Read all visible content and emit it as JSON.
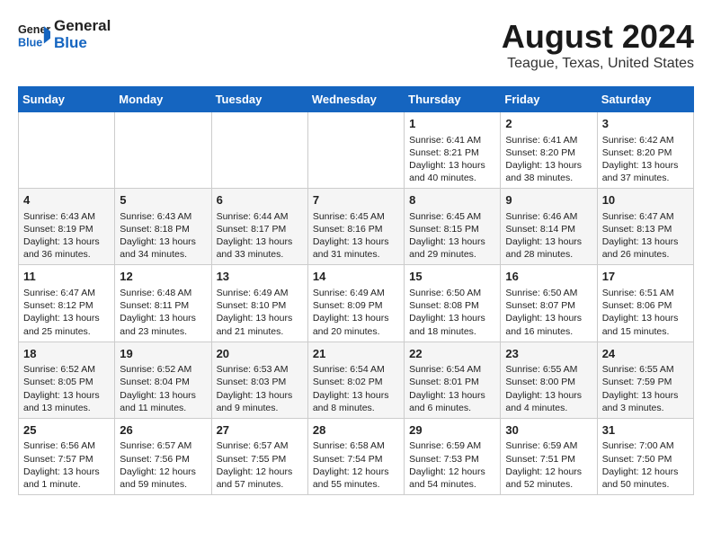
{
  "header": {
    "logo_line1": "General",
    "logo_line2": "Blue",
    "title": "August 2024",
    "subtitle": "Teague, Texas, United States"
  },
  "columns": [
    "Sunday",
    "Monday",
    "Tuesday",
    "Wednesday",
    "Thursday",
    "Friday",
    "Saturday"
  ],
  "weeks": [
    {
      "days": [
        {
          "num": "",
          "content": ""
        },
        {
          "num": "",
          "content": ""
        },
        {
          "num": "",
          "content": ""
        },
        {
          "num": "",
          "content": ""
        },
        {
          "num": "1",
          "content": "Sunrise: 6:41 AM\nSunset: 8:21 PM\nDaylight: 13 hours\nand 40 minutes."
        },
        {
          "num": "2",
          "content": "Sunrise: 6:41 AM\nSunset: 8:20 PM\nDaylight: 13 hours\nand 38 minutes."
        },
        {
          "num": "3",
          "content": "Sunrise: 6:42 AM\nSunset: 8:20 PM\nDaylight: 13 hours\nand 37 minutes."
        }
      ]
    },
    {
      "days": [
        {
          "num": "4",
          "content": "Sunrise: 6:43 AM\nSunset: 8:19 PM\nDaylight: 13 hours\nand 36 minutes."
        },
        {
          "num": "5",
          "content": "Sunrise: 6:43 AM\nSunset: 8:18 PM\nDaylight: 13 hours\nand 34 minutes."
        },
        {
          "num": "6",
          "content": "Sunrise: 6:44 AM\nSunset: 8:17 PM\nDaylight: 13 hours\nand 33 minutes."
        },
        {
          "num": "7",
          "content": "Sunrise: 6:45 AM\nSunset: 8:16 PM\nDaylight: 13 hours\nand 31 minutes."
        },
        {
          "num": "8",
          "content": "Sunrise: 6:45 AM\nSunset: 8:15 PM\nDaylight: 13 hours\nand 29 minutes."
        },
        {
          "num": "9",
          "content": "Sunrise: 6:46 AM\nSunset: 8:14 PM\nDaylight: 13 hours\nand 28 minutes."
        },
        {
          "num": "10",
          "content": "Sunrise: 6:47 AM\nSunset: 8:13 PM\nDaylight: 13 hours\nand 26 minutes."
        }
      ]
    },
    {
      "days": [
        {
          "num": "11",
          "content": "Sunrise: 6:47 AM\nSunset: 8:12 PM\nDaylight: 13 hours\nand 25 minutes."
        },
        {
          "num": "12",
          "content": "Sunrise: 6:48 AM\nSunset: 8:11 PM\nDaylight: 13 hours\nand 23 minutes."
        },
        {
          "num": "13",
          "content": "Sunrise: 6:49 AM\nSunset: 8:10 PM\nDaylight: 13 hours\nand 21 minutes."
        },
        {
          "num": "14",
          "content": "Sunrise: 6:49 AM\nSunset: 8:09 PM\nDaylight: 13 hours\nand 20 minutes."
        },
        {
          "num": "15",
          "content": "Sunrise: 6:50 AM\nSunset: 8:08 PM\nDaylight: 13 hours\nand 18 minutes."
        },
        {
          "num": "16",
          "content": "Sunrise: 6:50 AM\nSunset: 8:07 PM\nDaylight: 13 hours\nand 16 minutes."
        },
        {
          "num": "17",
          "content": "Sunrise: 6:51 AM\nSunset: 8:06 PM\nDaylight: 13 hours\nand 15 minutes."
        }
      ]
    },
    {
      "days": [
        {
          "num": "18",
          "content": "Sunrise: 6:52 AM\nSunset: 8:05 PM\nDaylight: 13 hours\nand 13 minutes."
        },
        {
          "num": "19",
          "content": "Sunrise: 6:52 AM\nSunset: 8:04 PM\nDaylight: 13 hours\nand 11 minutes."
        },
        {
          "num": "20",
          "content": "Sunrise: 6:53 AM\nSunset: 8:03 PM\nDaylight: 13 hours\nand 9 minutes."
        },
        {
          "num": "21",
          "content": "Sunrise: 6:54 AM\nSunset: 8:02 PM\nDaylight: 13 hours\nand 8 minutes."
        },
        {
          "num": "22",
          "content": "Sunrise: 6:54 AM\nSunset: 8:01 PM\nDaylight: 13 hours\nand 6 minutes."
        },
        {
          "num": "23",
          "content": "Sunrise: 6:55 AM\nSunset: 8:00 PM\nDaylight: 13 hours\nand 4 minutes."
        },
        {
          "num": "24",
          "content": "Sunrise: 6:55 AM\nSunset: 7:59 PM\nDaylight: 13 hours\nand 3 minutes."
        }
      ]
    },
    {
      "days": [
        {
          "num": "25",
          "content": "Sunrise: 6:56 AM\nSunset: 7:57 PM\nDaylight: 13 hours\nand 1 minute."
        },
        {
          "num": "26",
          "content": "Sunrise: 6:57 AM\nSunset: 7:56 PM\nDaylight: 12 hours\nand 59 minutes."
        },
        {
          "num": "27",
          "content": "Sunrise: 6:57 AM\nSunset: 7:55 PM\nDaylight: 12 hours\nand 57 minutes."
        },
        {
          "num": "28",
          "content": "Sunrise: 6:58 AM\nSunset: 7:54 PM\nDaylight: 12 hours\nand 55 minutes."
        },
        {
          "num": "29",
          "content": "Sunrise: 6:59 AM\nSunset: 7:53 PM\nDaylight: 12 hours\nand 54 minutes."
        },
        {
          "num": "30",
          "content": "Sunrise: 6:59 AM\nSunset: 7:51 PM\nDaylight: 12 hours\nand 52 minutes."
        },
        {
          "num": "31",
          "content": "Sunrise: 7:00 AM\nSunset: 7:50 PM\nDaylight: 12 hours\nand 50 minutes."
        }
      ]
    }
  ]
}
